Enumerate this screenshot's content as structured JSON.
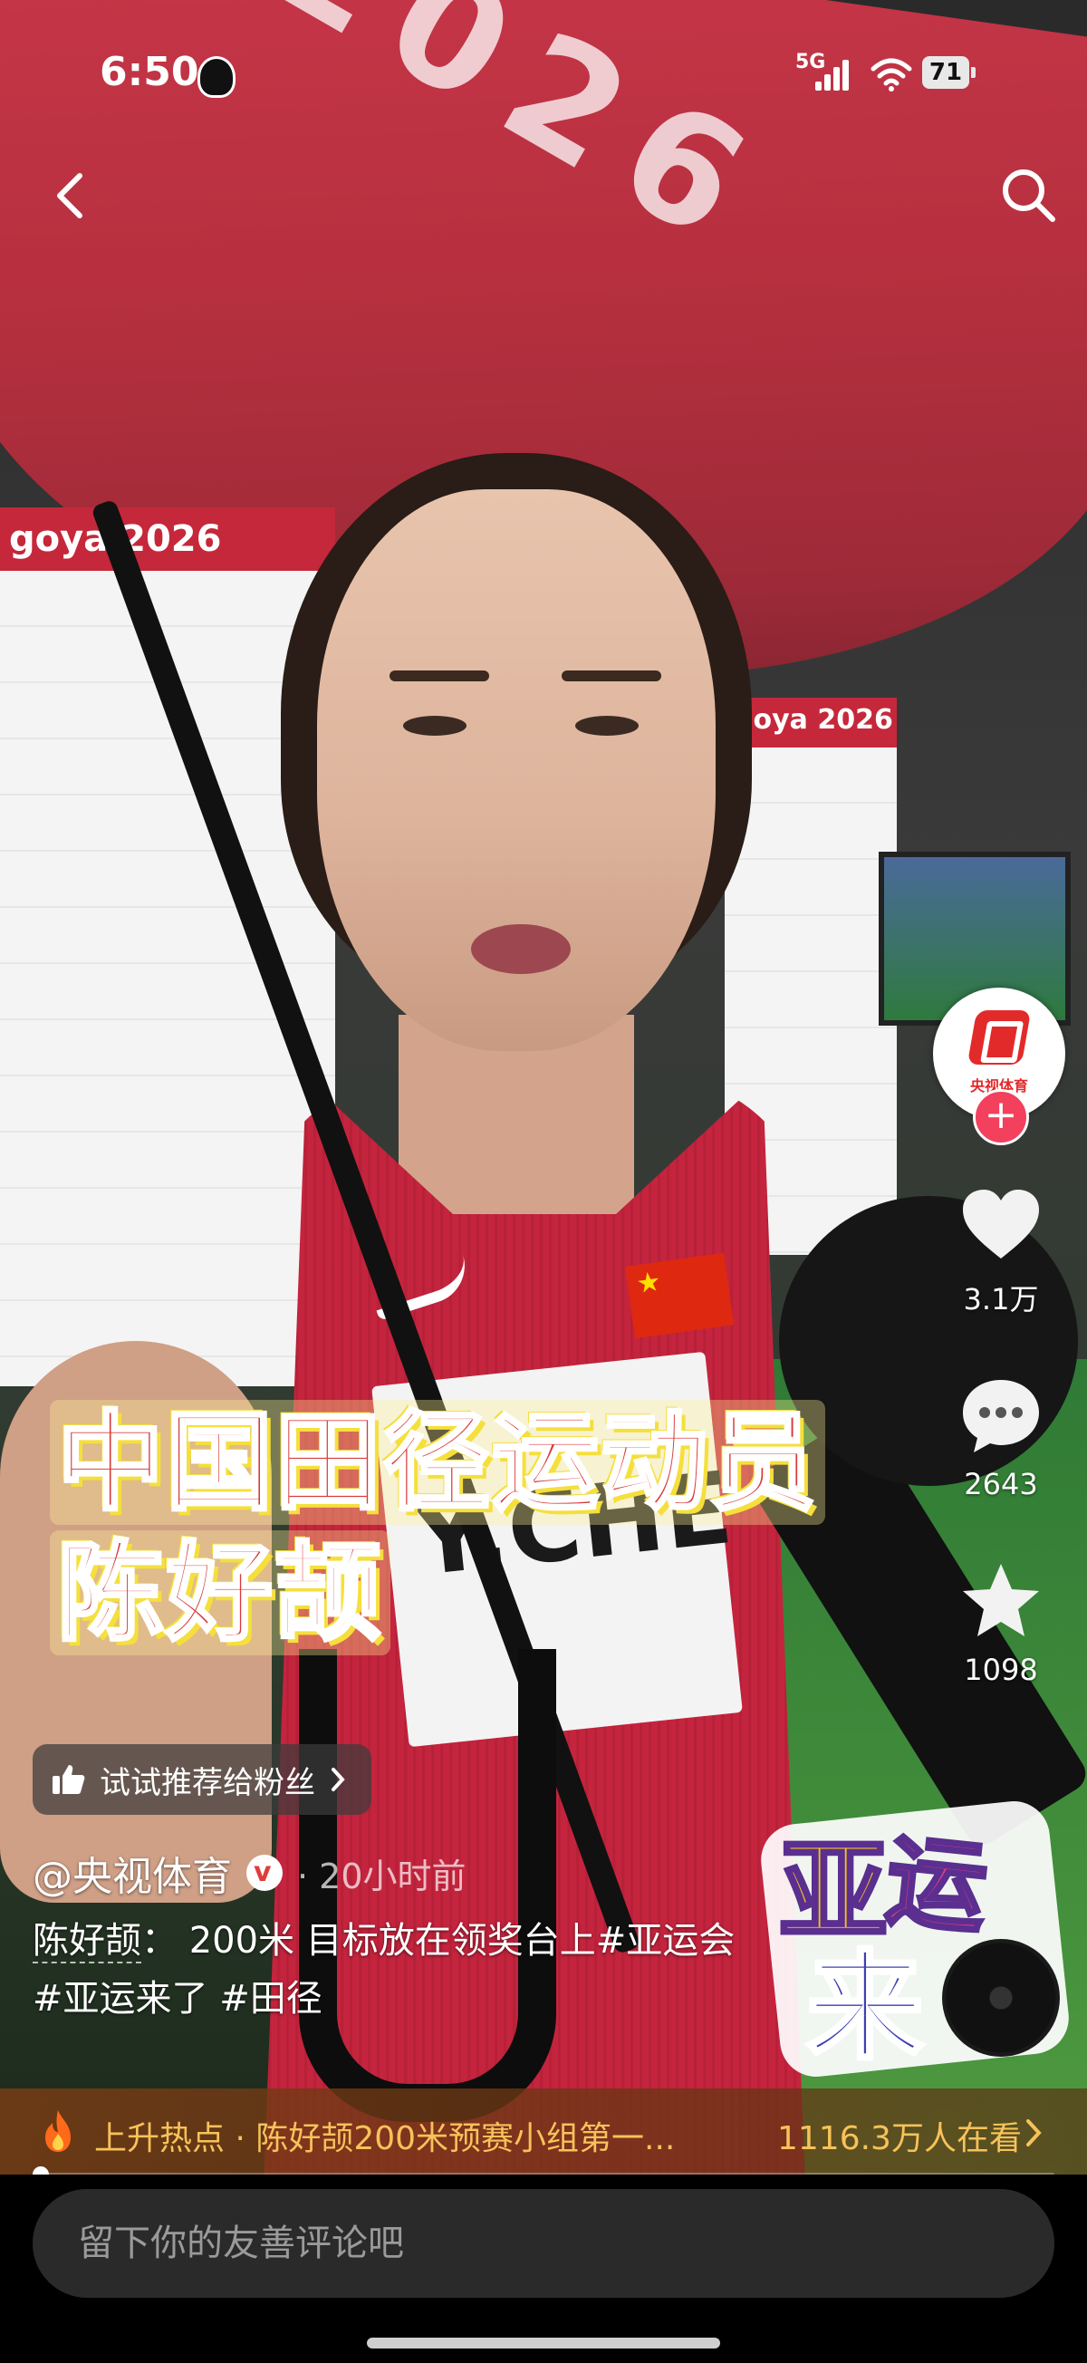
{
  "status_bar": {
    "time": "6:50",
    "network": "5G",
    "battery": "71"
  },
  "caption": {
    "line1": "中国田径运动员",
    "line2": "陈好颉"
  },
  "rail": {
    "avatar_name": "央视体育",
    "follow_symbol": "+",
    "likes": "3.1万",
    "comments": "2643",
    "favorites": "1098"
  },
  "recommend": {
    "label": "试试推荐给粉丝"
  },
  "post": {
    "author": "@央视体育",
    "time": "· 20小时前",
    "desc_name": "陈好颉",
    "desc_text": "： 200米 目标放在领奖台上#亚运会",
    "tags_line": "#亚运来了 #田径"
  },
  "sticker": {
    "char1": "亚",
    "char2": "运",
    "char3": "来"
  },
  "hot": {
    "text": "上升热点 · 陈好颉200米预赛小组第一...",
    "count": "1116.3万人在看"
  },
  "progress": {
    "value": 0.005
  },
  "comment": {
    "placeholder": "留下你的友善评论吧"
  },
  "colors": {
    "accent_red": "#f2405d",
    "hot_gold": "#f7c25a",
    "caption_red": "#d83a3a",
    "caption_yellow": "#f5df3c"
  }
}
